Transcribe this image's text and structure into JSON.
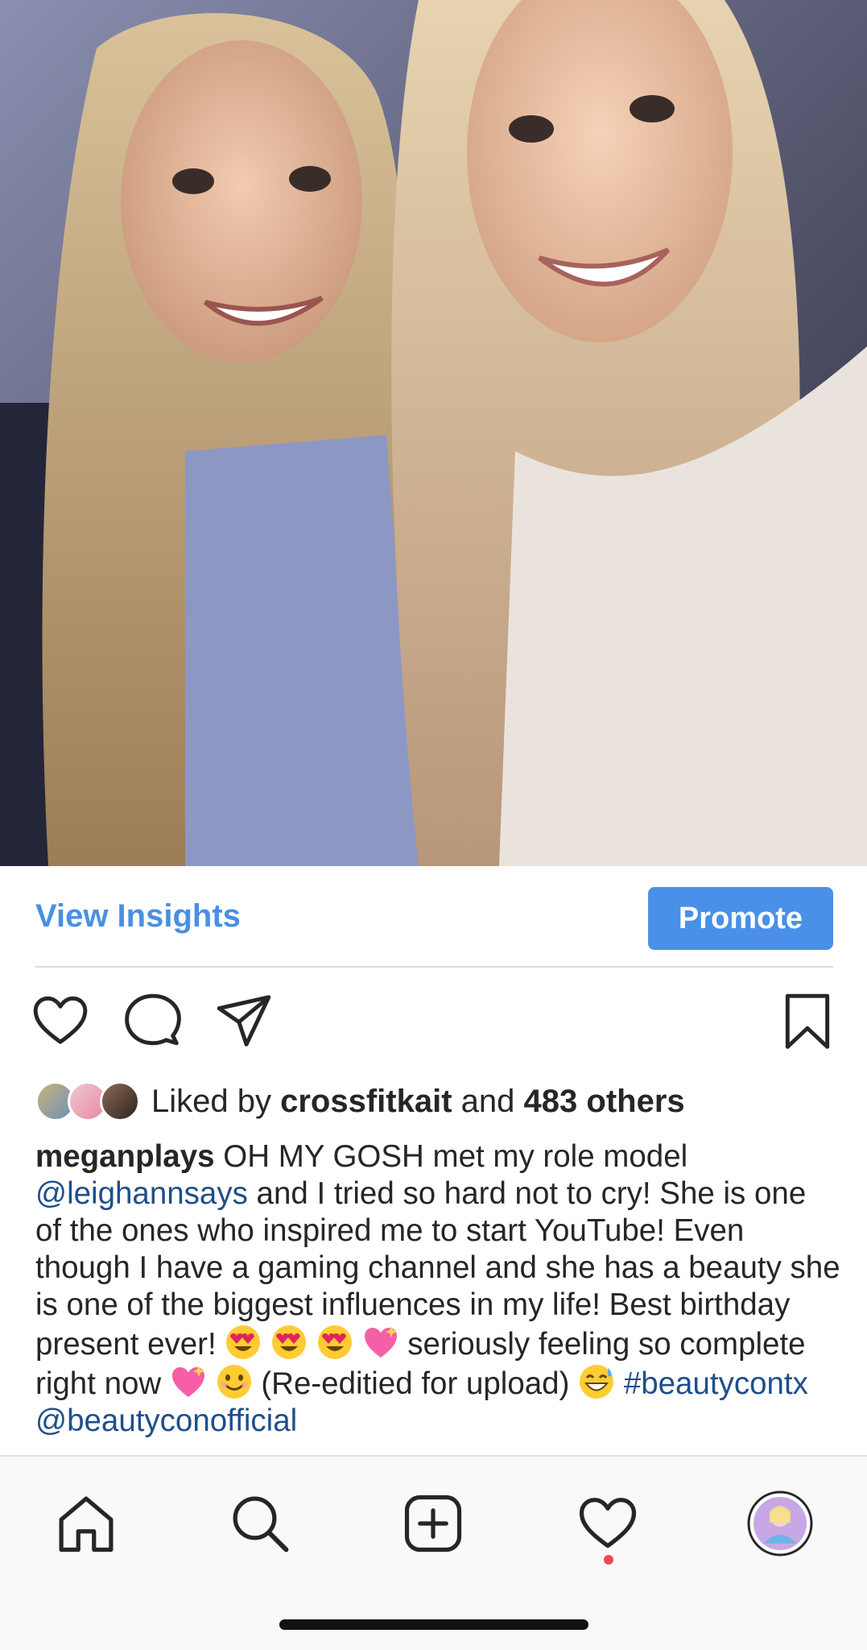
{
  "post": {
    "photo_alt": "Selfie of two smiling women",
    "view_insights_label": "View Insights",
    "promote_label": "Promote"
  },
  "actions": {
    "like_icon": "heart-outline-icon",
    "comment_icon": "comment-icon",
    "share_icon": "paper-plane-icon",
    "save_icon": "bookmark-icon"
  },
  "likes": {
    "prefix": "Liked by",
    "user": "crossfitkait",
    "joiner": "and",
    "others": "483 others"
  },
  "caption": {
    "username": "meganplays",
    "text_1": "OH MY GOSH met my role model",
    "mention_1": "@leighannsays",
    "text_2": "and I tried so hard not to cry! She is one of the ones who inspired me to start YouTube! Even though I have a gaming channel and she has a beauty she is one of the biggest influences in my life! Best birthday present ever!",
    "text_3": "seriously feeling so complete right now",
    "text_4": "(Re-editied for upload)",
    "hashtag": "#beautycontx",
    "mention_2": "@beautyconofficial"
  },
  "tabbar": {
    "tabs": [
      "home-icon",
      "search-icon",
      "new-post-icon",
      "activity-heart-icon",
      "profile-avatar"
    ]
  },
  "colors": {
    "link_blue": "#4a8fe2",
    "promote_bg": "#4a90e8",
    "mention_blue": "#1e4f8a",
    "notif_red": "#ed4956"
  }
}
